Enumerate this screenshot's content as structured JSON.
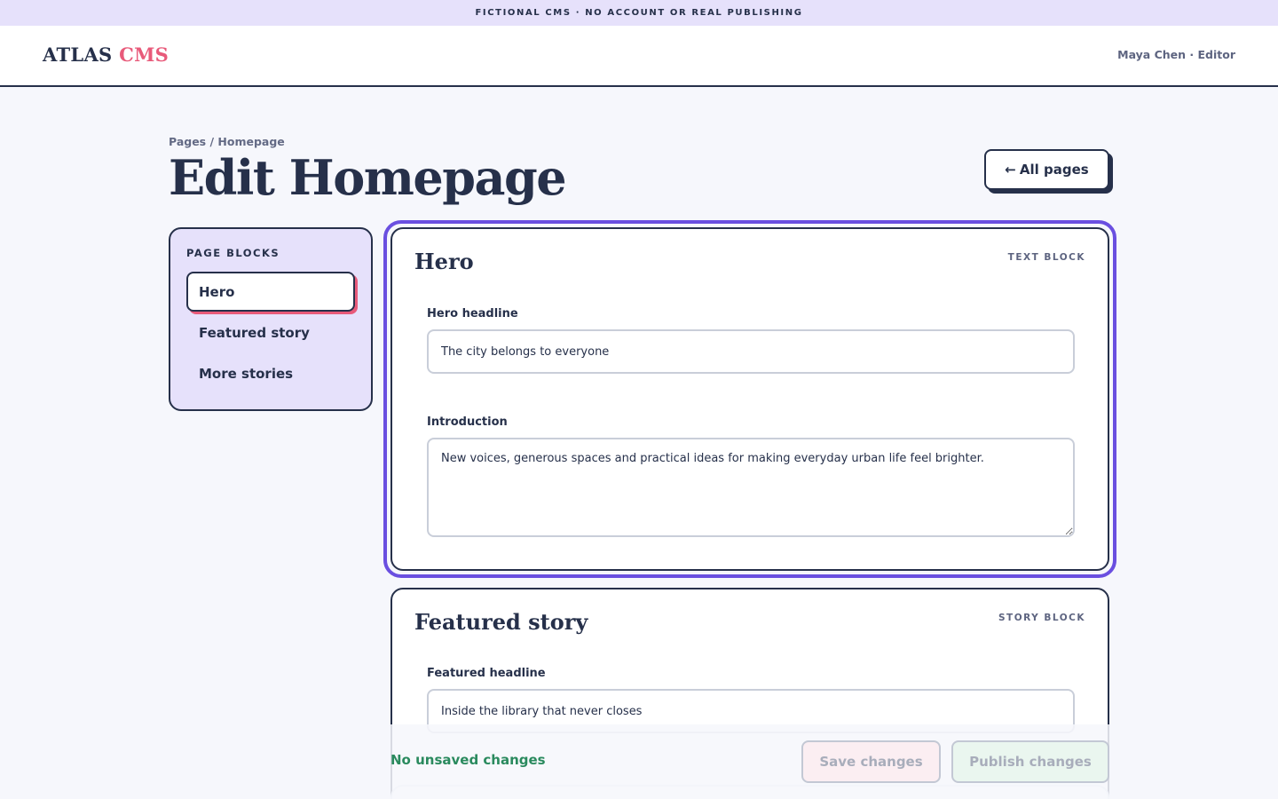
{
  "banner": {
    "text": "FICTIONAL CMS · NO ACCOUNT OR REAL PUBLISHING"
  },
  "header": {
    "logo_main": "ATLAS",
    "logo_accent": "CMS",
    "user": "Maya Chen · Editor"
  },
  "page": {
    "breadcrumb": "Pages / Homepage",
    "title": "Edit Homepage",
    "back_arrow": "←",
    "back_label": "All pages"
  },
  "sidebar": {
    "title": "PAGE BLOCKS",
    "items": [
      {
        "label": "Hero",
        "active": true
      },
      {
        "label": "Featured story",
        "active": false
      },
      {
        "label": "More stories",
        "active": false
      }
    ]
  },
  "hero": {
    "title": "Hero",
    "tag": "TEXT BLOCK",
    "headline_label": "Hero headline",
    "headline_value": "The city belongs to everyone",
    "intro_label": "Introduction",
    "intro_value": "New voices, generous spaces and practical ideas for making everyday urban life feel brighter."
  },
  "featured": {
    "title": "Featured story",
    "tag": "STORY BLOCK",
    "headline_label": "Featured headline",
    "headline_value": "Inside the library that never closes"
  },
  "footer": {
    "status": "No unsaved changes",
    "save_label": "Save changes",
    "publish_label": "Publish changes"
  },
  "colors": {
    "accent": "#e85a7a",
    "focus": "#6a4fe0",
    "ink": "#26304a",
    "status_ok": "#2a8a5e",
    "banner_bg": "#e6e1fb"
  }
}
